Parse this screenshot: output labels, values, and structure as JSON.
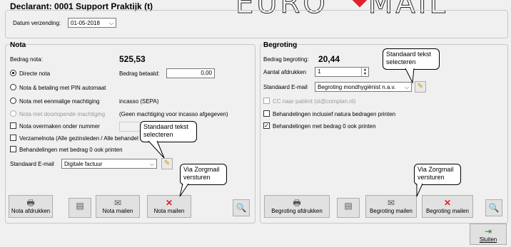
{
  "logo": {
    "left": "EURO",
    "right": "MAIL"
  },
  "title": "Declarant: 0001 Support Praktijk (t)",
  "datum": {
    "label": "Datum verzending:",
    "value": "01-05-2018"
  },
  "nota": {
    "title": "Nota",
    "bedrag_label": "Bedrag nota:",
    "bedrag_value": "525,53",
    "betaald_label": "Bedrag betaald:",
    "betaald_value": "0,00",
    "radios": [
      {
        "label": "Directe nota",
        "selected": true,
        "enabled": true
      },
      {
        "label": "Nota & betaling met PIN automaat",
        "selected": false,
        "enabled": true
      },
      {
        "label": "Nota met eenmalige machtiging",
        "selected": false,
        "enabled": true
      },
      {
        "label": "Nota met doorlopende machtiging",
        "selected": false,
        "enabled": false
      }
    ],
    "incasso_text": "incasso (SEPA)",
    "machtiging_text": "(Geen machtiging voor incasso afgegeven)",
    "check_overmaken": "Nota overmaken onder nummer",
    "check_verzamel": "Verzamelnota (Alle gezinsleden / Alle behandel",
    "check_bedrag0": "Behandelingen met bedrag 0 ook printen",
    "email_label": "Standaard E-mail",
    "email_value": "Digitale factuur",
    "btn_afdrukken": "Nota afdrukken",
    "btn_mailen": "Nota mailen",
    "btn_mailen2": "Nota mailen"
  },
  "begroting": {
    "title": "Begroting",
    "bedrag_label": "Bedrag begroting:",
    "bedrag_value": "20,44",
    "aantal_label": "Aantal afdrukken",
    "aantal_value": "1",
    "email_label": "Standaard E-mail",
    "email_value": "Begroting mondhygiënist n.a.v.",
    "check_cc": "CC naar patiënt (sl@complan.nl)",
    "check_natura": "Behandelingen inclusief natura bedragen printen",
    "check_bedrag0": "Behandelingen met bedrag 0 ook printen",
    "check_bedrag0_checked": true,
    "btn_afdrukken": "Begroting afdrukken",
    "btn_mailen": "Begroting mailen",
    "btn_mailen2": "Begroting mailen"
  },
  "callouts": {
    "standaard_tekst": "Standaard tekst selecteren",
    "via_zorgmail": "Via Zorgmail versturen"
  },
  "sluiten": "Sluiten"
}
